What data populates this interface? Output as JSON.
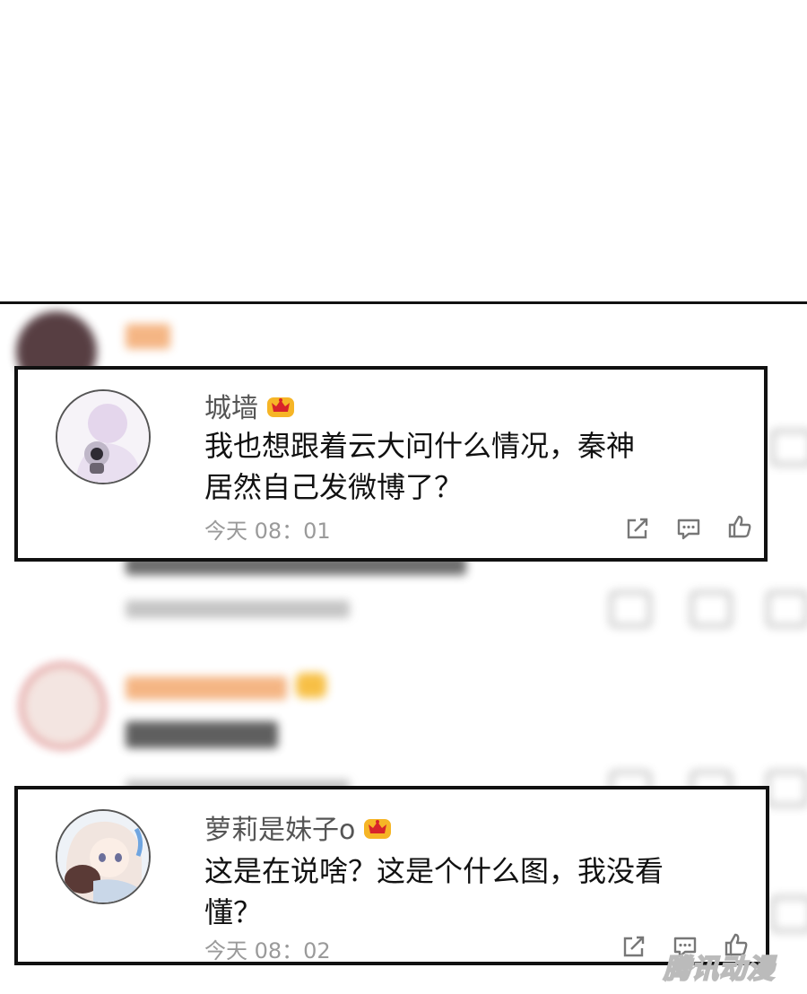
{
  "comments": [
    {
      "username": "城墙",
      "text_line1": "我也想跟着云大问什么情况，秦神",
      "text_line2": "居然自己发微博了？",
      "time": "今天  08：01"
    },
    {
      "username": "萝莉是妹子o",
      "text_line1": "这是在说啥？这是个什么图，我没看",
      "text_line2": "懂？",
      "time": "今天  08：02"
    }
  ],
  "icons": {
    "badge": "crown-badge-icon",
    "share": "share-icon",
    "reply": "comment-icon",
    "like": "thumbs-up-icon"
  },
  "colors": {
    "crown": "#f6b526",
    "crown_red": "#d8232a",
    "blurred_username": "#f08a3c"
  },
  "watermark": "腾讯动漫"
}
